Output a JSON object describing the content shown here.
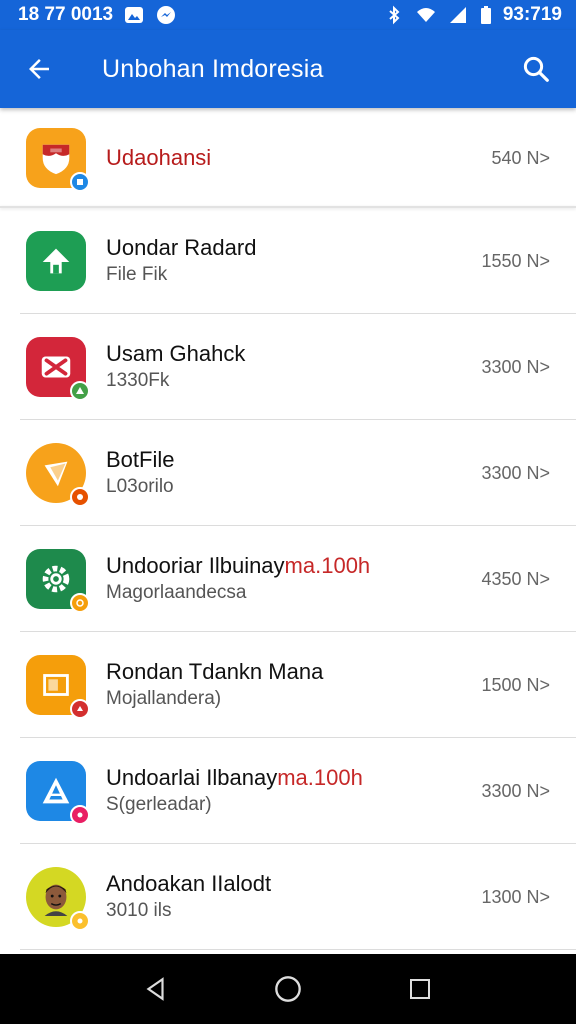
{
  "status_bar": {
    "left_text": "18 77 0013",
    "time": "93:719",
    "icons": [
      "gallery-icon",
      "messenger-icon",
      "bluetooth-icon",
      "wifi-icon",
      "signal-icon",
      "battery-icon"
    ]
  },
  "app_bar": {
    "title": "Unbohan Imdoresia",
    "color": "#1565d8"
  },
  "items": [
    {
      "title": "Udaohansi",
      "title_accent": "",
      "subtitle": "",
      "size": "540 N>",
      "icon": "shield-icon",
      "icon_color": "#f7a21b",
      "badge_color": "#1e88e5",
      "title_color": "#b71c1c"
    },
    {
      "title": "Uondar Radard",
      "title_accent": "",
      "subtitle": "File Fik",
      "size": "1550 N>",
      "icon": "home-arrow-icon",
      "icon_color": "#1e9e54",
      "badge_color": ""
    },
    {
      "title": "Usam Ghahck",
      "title_accent": "",
      "subtitle": "1330Fk",
      "size": "3300 N>",
      "icon": "crossed-tools-icon",
      "icon_color": "#d3263a",
      "badge_color": "#43a047"
    },
    {
      "title": "BotFile",
      "title_accent": "",
      "subtitle": "L03orilo",
      "size": "3300 N>",
      "icon": "leaf-icon",
      "icon_color": "#f7a21b",
      "badge_color": "#e65100"
    },
    {
      "title": "Undooriar Ilbuinay",
      "title_accent": "ma.100h",
      "subtitle": "Magorlaandecsa",
      "size": "4350 N>",
      "icon": "gear-icon",
      "icon_color": "#1e8a4c",
      "badge_color": "#f59e0b"
    },
    {
      "title": "Rondan Tdankn Mana",
      "title_accent": "",
      "subtitle": "Mojallandera)",
      "size": "1500 N>",
      "icon": "frame-icon",
      "icon_color": "#f59e0b",
      "badge_color": "#d32f2f"
    },
    {
      "title": "Undoarlai Ilbanay",
      "title_accent": "ma.100h",
      "subtitle": "S(gerleadar)",
      "size": "3300 N>",
      "icon": "triangle-a-icon",
      "icon_color": "#1e88e5",
      "badge_color": "#e91e63"
    },
    {
      "title": "Andoakan IIalodt",
      "title_accent": "",
      "subtitle": "3010 ils",
      "size": "1300 N>",
      "icon": "avatar-face-icon",
      "icon_color": "#d4d823",
      "badge_color": "#fbc02d"
    }
  ]
}
